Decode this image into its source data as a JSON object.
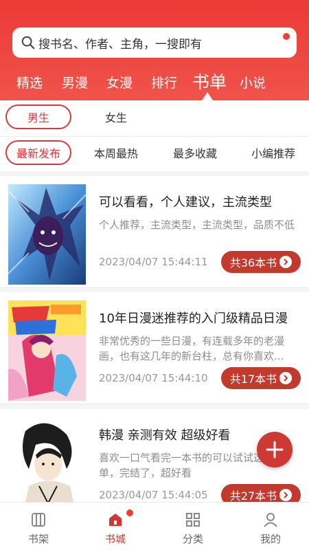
{
  "search": {
    "placeholder": "搜书名、作者、主角，一搜即有"
  },
  "tabs": [
    "精选",
    "男漫",
    "女漫",
    "排行",
    "书单",
    "小说"
  ],
  "active_tab": "书单",
  "gender": [
    "男生",
    "女生"
  ],
  "sort": [
    "最新发布",
    "本周最热",
    "最多收藏",
    "小编推荐"
  ],
  "lists": [
    {
      "title": "可以看看，个人建议，主流类型",
      "desc": "个人推荐，主流类型，主流类型，品质不低",
      "date": "2023/04/07 15:44:11",
      "count": "共36本书"
    },
    {
      "title": "10年日漫迷推荐的入门级精品日漫",
      "desc": "非常优秀的一些日漫，有连载多年的老漫画，也有这几年的新台柱，总有你喜欢...",
      "date": "2023/04/07 15:44:10",
      "count": "共17本书"
    },
    {
      "title": "韩漫  亲测有效  超级好看",
      "desc": "喜欢一口气看完一本书的可以试试这个书单，完结了，超好看",
      "date": "2023/04/07 15:44:05",
      "count": "共27本书"
    }
  ],
  "bottom_nav": [
    "书架",
    "书城",
    "分类",
    "我的"
  ],
  "colors": {
    "accent": "#ec3a35",
    "button": "#c2392e",
    "text_gray": "#8d8d8d"
  }
}
